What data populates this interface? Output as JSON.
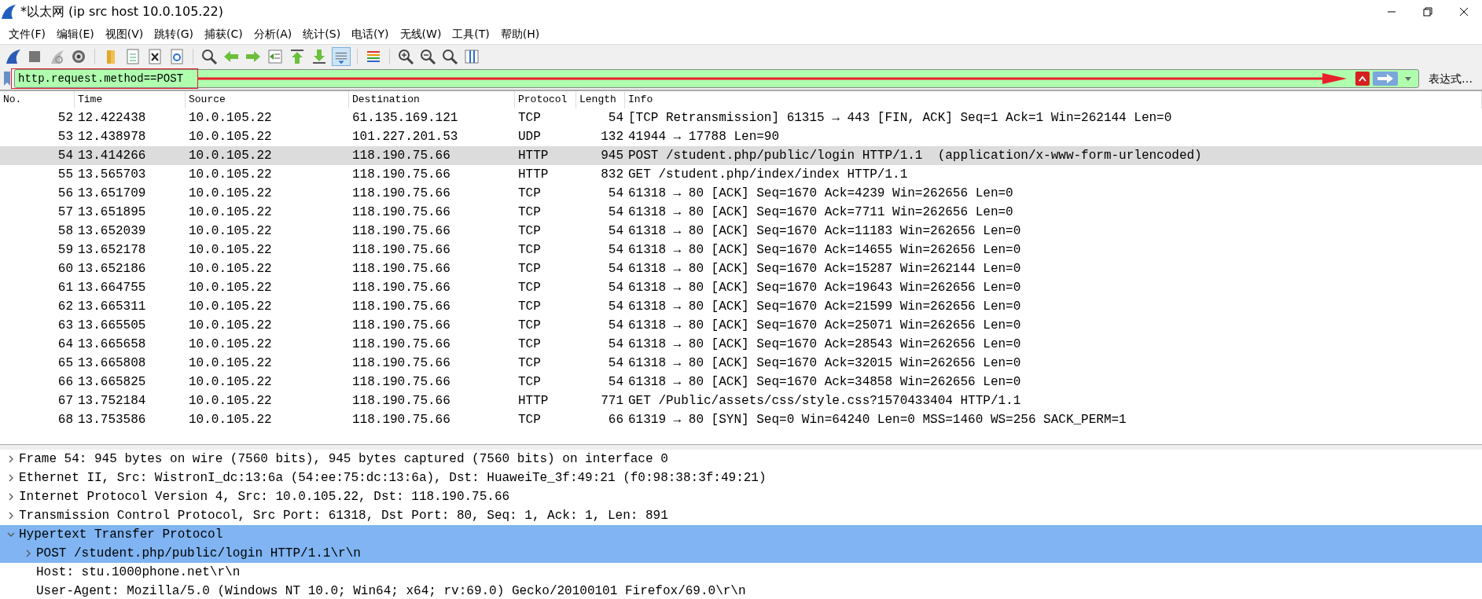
{
  "window": {
    "title": "*以太网 (ip src host 10.0.105.22)"
  },
  "menu": [
    "文件(F)",
    "编辑(E)",
    "视图(V)",
    "跳转(G)",
    "捕获(C)",
    "分析(A)",
    "统计(S)",
    "电话(Y)",
    "无线(W)",
    "工具(T)",
    "帮助(H)"
  ],
  "filter": {
    "value": "http.request.method==POST",
    "valid": true,
    "expression_button": "表达式…"
  },
  "packet_list": {
    "columns": [
      "No.",
      "Time",
      "Source",
      "Destination",
      "Protocol",
      "Length",
      "Info"
    ],
    "rows": [
      {
        "no": "52",
        "time": "12.422438",
        "source": "10.0.105.22",
        "destination": "61.135.169.121",
        "protocol": "TCP",
        "length": "54",
        "info": "[TCP Retransmission] 61315 → 443 [FIN, ACK] Seq=1 Ack=1 Win=262144 Len=0",
        "selected": false
      },
      {
        "no": "53",
        "time": "12.438978",
        "source": "10.0.105.22",
        "destination": "101.227.201.53",
        "protocol": "UDP",
        "length": "132",
        "info": "41944 → 17788 Len=90",
        "selected": false
      },
      {
        "no": "54",
        "time": "13.414266",
        "source": "10.0.105.22",
        "destination": "118.190.75.66",
        "protocol": "HTTP",
        "length": "945",
        "info": "POST /student.php/public/login HTTP/1.1  (application/x-www-form-urlencoded)",
        "selected": true
      },
      {
        "no": "55",
        "time": "13.565703",
        "source": "10.0.105.22",
        "destination": "118.190.75.66",
        "protocol": "HTTP",
        "length": "832",
        "info": "GET /student.php/index/index HTTP/1.1",
        "selected": false
      },
      {
        "no": "56",
        "time": "13.651709",
        "source": "10.0.105.22",
        "destination": "118.190.75.66",
        "protocol": "TCP",
        "length": "54",
        "info": "61318 → 80 [ACK] Seq=1670 Ack=4239 Win=262656 Len=0",
        "selected": false
      },
      {
        "no": "57",
        "time": "13.651895",
        "source": "10.0.105.22",
        "destination": "118.190.75.66",
        "protocol": "TCP",
        "length": "54",
        "info": "61318 → 80 [ACK] Seq=1670 Ack=7711 Win=262656 Len=0",
        "selected": false
      },
      {
        "no": "58",
        "time": "13.652039",
        "source": "10.0.105.22",
        "destination": "118.190.75.66",
        "protocol": "TCP",
        "length": "54",
        "info": "61318 → 80 [ACK] Seq=1670 Ack=11183 Win=262656 Len=0",
        "selected": false
      },
      {
        "no": "59",
        "time": "13.652178",
        "source": "10.0.105.22",
        "destination": "118.190.75.66",
        "protocol": "TCP",
        "length": "54",
        "info": "61318 → 80 [ACK] Seq=1670 Ack=14655 Win=262656 Len=0",
        "selected": false
      },
      {
        "no": "60",
        "time": "13.652186",
        "source": "10.0.105.22",
        "destination": "118.190.75.66",
        "protocol": "TCP",
        "length": "54",
        "info": "61318 → 80 [ACK] Seq=1670 Ack=15287 Win=262144 Len=0",
        "selected": false
      },
      {
        "no": "61",
        "time": "13.664755",
        "source": "10.0.105.22",
        "destination": "118.190.75.66",
        "protocol": "TCP",
        "length": "54",
        "info": "61318 → 80 [ACK] Seq=1670 Ack=19643 Win=262656 Len=0",
        "selected": false
      },
      {
        "no": "62",
        "time": "13.665311",
        "source": "10.0.105.22",
        "destination": "118.190.75.66",
        "protocol": "TCP",
        "length": "54",
        "info": "61318 → 80 [ACK] Seq=1670 Ack=21599 Win=262656 Len=0",
        "selected": false
      },
      {
        "no": "63",
        "time": "13.665505",
        "source": "10.0.105.22",
        "destination": "118.190.75.66",
        "protocol": "TCP",
        "length": "54",
        "info": "61318 → 80 [ACK] Seq=1670 Ack=25071 Win=262656 Len=0",
        "selected": false
      },
      {
        "no": "64",
        "time": "13.665658",
        "source": "10.0.105.22",
        "destination": "118.190.75.66",
        "protocol": "TCP",
        "length": "54",
        "info": "61318 → 80 [ACK] Seq=1670 Ack=28543 Win=262656 Len=0",
        "selected": false
      },
      {
        "no": "65",
        "time": "13.665808",
        "source": "10.0.105.22",
        "destination": "118.190.75.66",
        "protocol": "TCP",
        "length": "54",
        "info": "61318 → 80 [ACK] Seq=1670 Ack=32015 Win=262656 Len=0",
        "selected": false
      },
      {
        "no": "66",
        "time": "13.665825",
        "source": "10.0.105.22",
        "destination": "118.190.75.66",
        "protocol": "TCP",
        "length": "54",
        "info": "61318 → 80 [ACK] Seq=1670 Ack=34858 Win=262656 Len=0",
        "selected": false
      },
      {
        "no": "67",
        "time": "13.752184",
        "source": "10.0.105.22",
        "destination": "118.190.75.66",
        "protocol": "HTTP",
        "length": "771",
        "info": "GET /Public/assets/css/style.css?1570433404 HTTP/1.1",
        "selected": false
      },
      {
        "no": "68",
        "time": "13.753586",
        "source": "10.0.105.22",
        "destination": "118.190.75.66",
        "protocol": "TCP",
        "length": "66",
        "info": "61319 → 80 [SYN] Seq=0 Win=64240 Len=0 MSS=1460 WS=256 SACK_PERM=1",
        "selected": false
      }
    ]
  },
  "packet_details": [
    {
      "label": "Frame 54: 945 bytes on wire (7560 bits), 945 bytes captured (7560 bits) on interface 0",
      "kind": "branch",
      "expanded": false,
      "selected": false
    },
    {
      "label": "Ethernet II, Src: WistronI_dc:13:6a (54:ee:75:dc:13:6a), Dst: HuaweiTe_3f:49:21 (f0:98:38:3f:49:21)",
      "kind": "branch",
      "expanded": false,
      "selected": false
    },
    {
      "label": "Internet Protocol Version 4, Src: 10.0.105.22, Dst: 118.190.75.66",
      "kind": "branch",
      "expanded": false,
      "selected": false
    },
    {
      "label": "Transmission Control Protocol, Src Port: 61318, Dst Port: 80, Seq: 1, Ack: 1, Len: 891",
      "kind": "branch",
      "expanded": false,
      "selected": false
    },
    {
      "label": "Hypertext Transfer Protocol",
      "kind": "branch",
      "expanded": true,
      "selected": true,
      "children": [
        {
          "label": "POST /student.php/public/login HTTP/1.1\\r\\n",
          "kind": "branch",
          "expanded": false,
          "selected": true
        },
        {
          "label": "Host: stu.1000phone.net\\r\\n",
          "kind": "leaf",
          "selected": false
        },
        {
          "label": "User-Agent: Mozilla/5.0 (Windows NT 10.0; Win64; x64; rv:69.0) Gecko/20100101 Firefox/69.0\\r\\n",
          "kind": "leaf",
          "selected": false
        }
      ]
    }
  ]
}
